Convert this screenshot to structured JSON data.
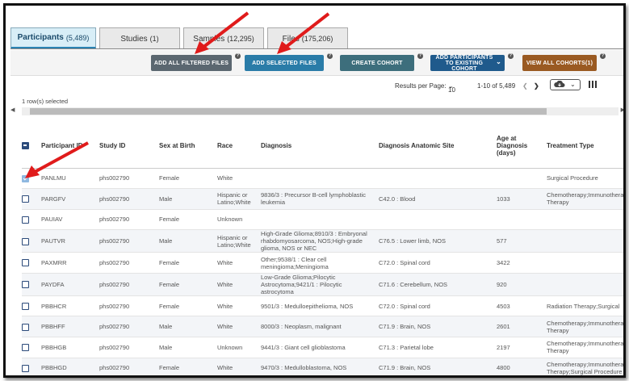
{
  "tabs": [
    {
      "label": "Participants",
      "count": "(5,489)"
    },
    {
      "label": "Studies",
      "count": "(1)"
    },
    {
      "label": "Samples",
      "count": "(12,295)"
    },
    {
      "label": "Files",
      "count": "(175,206)"
    }
  ],
  "actions": {
    "add_all_filtered": "ADD ALL FILTERED FILES",
    "add_selected": "ADD SELECTED FILES",
    "create_cohort": "CREATE COHORT",
    "add_participants": "ADD PARTICIPANTS TO EXISTING COHORT",
    "view_all_cohorts": "VIEW ALL COHORTS(1)",
    "help": "?",
    "colors": {
      "gray": "#5b6770",
      "blue": "#2a7ca8",
      "teal": "#3d6e7c",
      "navy": "#1f5a8c",
      "brown": "#9a5a22"
    }
  },
  "pager": {
    "results_label": "Results per Page:",
    "per_page": "10",
    "range": "1-10 of 5,489"
  },
  "selection": "1 row(s) selected",
  "table": {
    "headers": [
      "Participant ID",
      "Study ID",
      "Sex at Birth",
      "Race",
      "Diagnosis",
      "Diagnosis Anatomic Site",
      "Age at Diagnosis (days)",
      "Treatment Type"
    ],
    "rows": [
      {
        "checked": true,
        "id": "PANLMU",
        "study": "phs002790",
        "sex": "Female",
        "race": "White",
        "dx": "",
        "site": "",
        "age": "",
        "tx": "Surgical Procedure"
      },
      {
        "checked": false,
        "id": "PARGFV",
        "study": "phs002790",
        "sex": "Male",
        "race": "Hispanic or Latino;White",
        "dx": "9836/3 : Precursor B-cell lymphoblastic leukemia",
        "site": "C42.0 : Blood",
        "age": "1033",
        "tx": "Chemotherapy;Immunotherapy Therapy"
      },
      {
        "checked": false,
        "id": "PAUIAV",
        "study": "phs002790",
        "sex": "Female",
        "race": "Unknown",
        "dx": "",
        "site": "",
        "age": "",
        "tx": ""
      },
      {
        "checked": false,
        "id": "PAUTVR",
        "study": "phs002790",
        "sex": "Male",
        "race": "Hispanic or Latino;White",
        "dx": "High-Grade Glioma;8910/3 : Embryonal rhabdomyosarcoma, NOS;High-grade glioma, NOS or NEC",
        "site": "C76.5 : Lower limb, NOS",
        "age": "577",
        "tx": ""
      },
      {
        "checked": false,
        "id": "PAXMRR",
        "study": "phs002790",
        "sex": "Female",
        "race": "White",
        "dx": "Other;9538/1 : Clear cell meningioma;Meningioma",
        "site": "C72.0 : Spinal cord",
        "age": "3422",
        "tx": ""
      },
      {
        "checked": false,
        "id": "PAYDFA",
        "study": "phs002790",
        "sex": "Female",
        "race": "White",
        "dx": "Low-Grade Glioma;Pilocytic Astrocytoma;9421/1 : Pilocytic astrocytoma",
        "site": "C71.6 : Cerebellum, NOS",
        "age": "920",
        "tx": ""
      },
      {
        "checked": false,
        "id": "PBBHCR",
        "study": "phs002790",
        "sex": "Female",
        "race": "White",
        "dx": "9501/3 : Medulloepithelioma, NOS",
        "site": "C72.0 : Spinal cord",
        "age": "4503",
        "tx": "Radiation Therapy;Surgical"
      },
      {
        "checked": false,
        "id": "PBBHFF",
        "study": "phs002790",
        "sex": "Male",
        "race": "White",
        "dx": "8000/3 : Neoplasm, malignant",
        "site": "C71.9 : Brain, NOS",
        "age": "2601",
        "tx": "Chemotherapy;Immunotherapy Therapy"
      },
      {
        "checked": false,
        "id": "PBBHGB",
        "study": "phs002790",
        "sex": "Male",
        "race": "Unknown",
        "dx": "9441/3 : Giant cell glioblastoma",
        "site": "C71.3 : Parietal lobe",
        "age": "2197",
        "tx": "Chemotherapy;Immunotherapy Therapy"
      },
      {
        "checked": false,
        "id": "PBBHGD",
        "study": "phs002790",
        "sex": "Female",
        "race": "White",
        "dx": "9470/3 : Medulloblastoma, NOS",
        "site": "C71.9 : Brain, NOS",
        "age": "4800",
        "tx": "Chemotherapy;Immunotherapy Therapy;Surgical Procedure"
      }
    ]
  }
}
